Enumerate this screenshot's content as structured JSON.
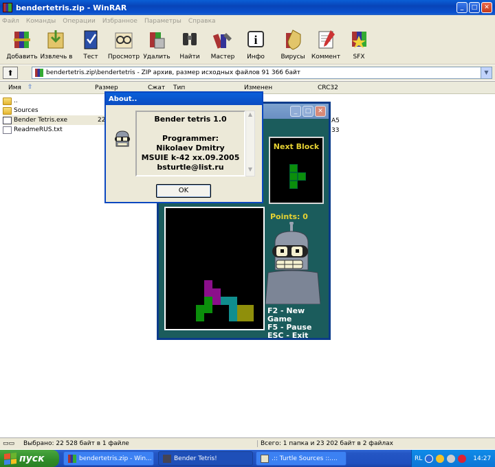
{
  "window": {
    "title": "bendertetris.zip - WinRAR"
  },
  "menu": [
    "Файл",
    "Команды",
    "Операции",
    "Избранное",
    "Параметры",
    "Справка"
  ],
  "toolbar": [
    {
      "label": "Добавить",
      "icon": "add-archive-icon"
    },
    {
      "label": "Извлечь в",
      "icon": "extract-icon"
    },
    {
      "label": "Тест",
      "icon": "test-icon"
    },
    {
      "label": "Просмотр",
      "icon": "view-icon"
    },
    {
      "label": "Удалить",
      "icon": "delete-icon"
    },
    {
      "label": "Найти",
      "icon": "find-icon"
    },
    {
      "label": "Мастер",
      "icon": "wizard-icon"
    },
    {
      "label": "Инфо",
      "icon": "info-icon"
    },
    {
      "label": "Вирусы",
      "icon": "virus-icon"
    },
    {
      "label": "Коммент",
      "icon": "comment-icon"
    },
    {
      "label": "SFX",
      "icon": "sfx-icon"
    }
  ],
  "address": {
    "path": "bendertetris.zip\\bendertetris - ZIP архив, размер исходных файлов 91 366 байт"
  },
  "columns": [
    "Имя",
    "Размер",
    "Сжат",
    "Тип",
    "Изменен",
    "CRC32"
  ],
  "files": [
    {
      "name": "..",
      "type": "folder"
    },
    {
      "name": "Sources",
      "type": "folder"
    },
    {
      "name": "Bender Tetris.exe",
      "type": "exe",
      "size_fragment": "22",
      "crc_fragment": "A5"
    },
    {
      "name": "ReadmeRUS.txt",
      "type": "txt",
      "crc_fragment": "33"
    }
  ],
  "status": {
    "left": "Выбрано: 22 528 байт в 1 файле",
    "right": "Всего: 1 папка и 23 202 байт в 2 файлах"
  },
  "about": {
    "title": "About..",
    "lines": [
      "Bender tetris 1.0",
      "",
      "Programmer:",
      "Nikolaev Dmitry",
      "MSUIE k-42 xx.09.2005",
      "bsturtle@list.ru"
    ],
    "ok": "OK"
  },
  "game": {
    "next_label": "Next Block",
    "points_label": "Points: 0",
    "keys": [
      "F2 - New Game",
      "F5 - Pause",
      "ESC - Exit"
    ],
    "colors": {
      "purple": "#8b0f8b",
      "teal": "#108e8e",
      "green": "#0b8f0b",
      "olive": "#8f8f0b"
    }
  },
  "taskbar": {
    "start": "пуск",
    "tasks": [
      "bendertetris.zip - Win...",
      "Bender Tetris!",
      ".:: Turtle Sources ::...."
    ],
    "lang": "RL",
    "clock": "14:27"
  }
}
